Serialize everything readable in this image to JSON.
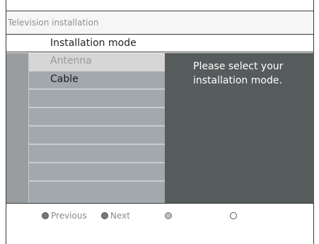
{
  "title": "Television installation",
  "menu": {
    "header": "Installation mode",
    "items": [
      {
        "label": "Antenna",
        "state": "highlighted"
      },
      {
        "label": "Cable",
        "state": "selected"
      },
      {
        "label": ""
      },
      {
        "label": ""
      },
      {
        "label": ""
      },
      {
        "label": ""
      },
      {
        "label": ""
      },
      {
        "label": ""
      }
    ]
  },
  "info": {
    "text": "Please select your installation mode."
  },
  "footer": {
    "previous_label": "Previous",
    "next_label": "Next"
  },
  "colors": {
    "info_panel": "#565b5c",
    "list_panel": "#a3a8ad",
    "highlight": "#d6d6d6"
  }
}
